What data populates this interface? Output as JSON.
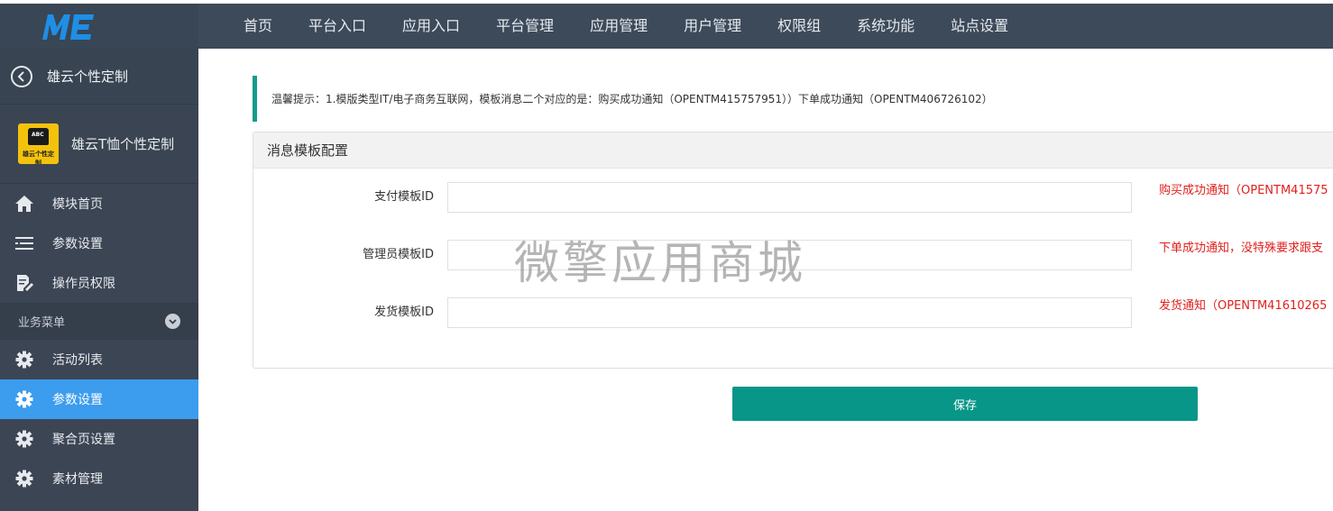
{
  "brand": {
    "logo_text": "ME"
  },
  "topnav": {
    "items": [
      "首页",
      "平台入口",
      "应用入口",
      "平台管理",
      "应用管理",
      "用户管理",
      "权限组",
      "系统功能",
      "站点设置"
    ]
  },
  "sidebar": {
    "back_title": "雄云个性定制",
    "app_name": "雄云T恤个性定制",
    "app_thumb_text": "ABC",
    "app_thumb_caption": "雄云个性定制",
    "menu_top": [
      "模块首页",
      "参数设置",
      "操作员权限"
    ],
    "group_title": "业务菜单",
    "group_items": [
      "活动列表",
      "参数设置",
      "聚合页设置",
      "素材管理"
    ],
    "active_item": "参数设置"
  },
  "tip": {
    "text": "温馨提示：1.模版类型IT/电子商务互联网，模板消息二个对应的是：购买成功通知（OPENTM415757951））下单成功通知（OPENTM406726102）"
  },
  "panel": {
    "title": "消息模板配置",
    "fields": [
      {
        "label": "支付模板ID",
        "value": "",
        "hint": "购买成功通知（OPENTM41575"
      },
      {
        "label": "管理员模板ID",
        "value": "",
        "hint": "下单成功通知，没特殊要求跟支"
      },
      {
        "label": "发货模板ID",
        "value": "",
        "hint": "发货通知（OPENTM41610265"
      }
    ]
  },
  "watermark": "微擎应用商城",
  "save_label": "保存",
  "colors": {
    "topbar": "#3c4a5a",
    "sidebar": "#3c4554",
    "active": "#3c9cee",
    "accent": "#079688",
    "hint": "#e0201c"
  }
}
